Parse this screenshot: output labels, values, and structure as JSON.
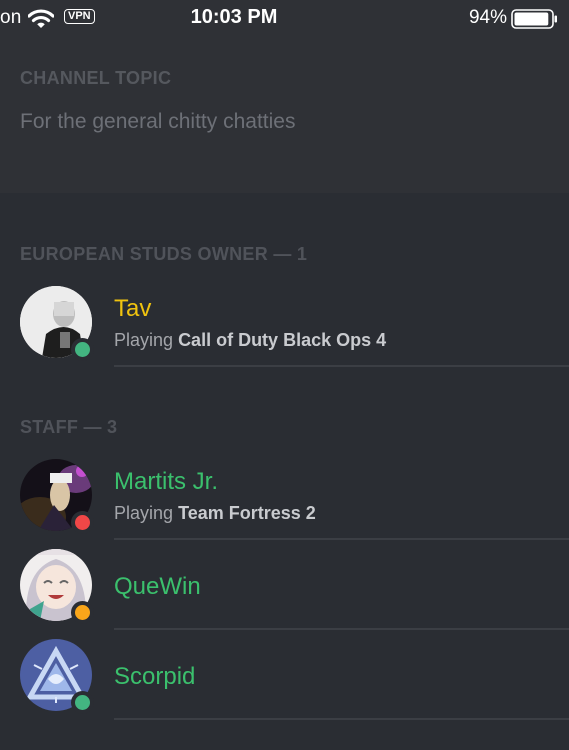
{
  "status_bar": {
    "carrier": "on",
    "vpn": "VPN",
    "time": "10:03 PM",
    "battery": "94%",
    "battery_level": 0.94
  },
  "topic": {
    "title": "CHANNEL TOPIC",
    "text": "For the general chitty chatties"
  },
  "sections": [
    {
      "header": "EUROPEAN STUDS OWNER — 1",
      "members": [
        {
          "name": "Tav",
          "name_color": "#f0c30f",
          "status": "online",
          "status_color": "#43b581",
          "activity_prefix": "Playing",
          "activity_game": "Call of Duty Black Ops 4"
        }
      ]
    },
    {
      "header": "STAFF — 3",
      "members": [
        {
          "name": "Martits Jr.",
          "name_color": "#3bc06d",
          "status": "dnd",
          "status_color": "#f04747",
          "activity_prefix": "Playing",
          "activity_game": "Team Fortress 2"
        },
        {
          "name": "QueWin",
          "name_color": "#3bc06d",
          "status": "idle",
          "status_color": "#faa61a"
        },
        {
          "name": "Scorpid",
          "name_color": "#3bc06d",
          "status": "online",
          "status_color": "#43b581"
        }
      ]
    }
  ]
}
